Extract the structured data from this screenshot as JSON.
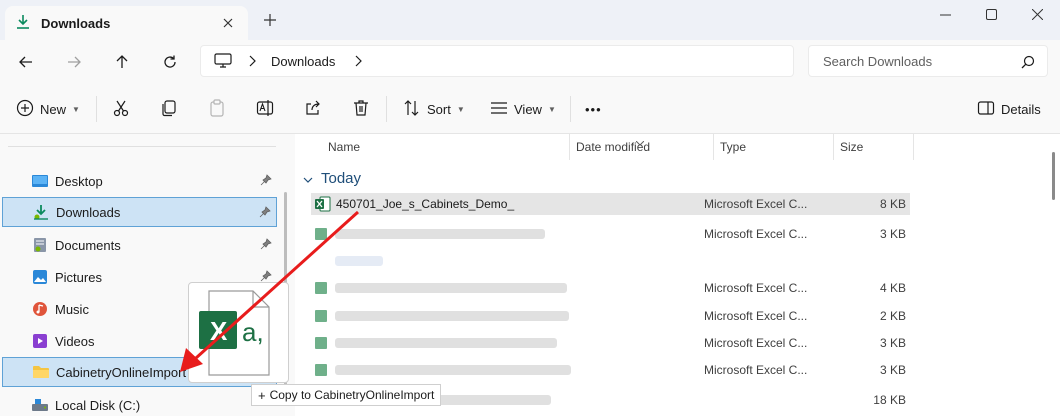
{
  "window": {
    "tab_title": "Downloads",
    "tab_icon": "download-icon",
    "new_tab_symbol": "+"
  },
  "address": {
    "crumb": "Downloads"
  },
  "search": {
    "placeholder": "Search Downloads"
  },
  "commandbar": {
    "new_label": "New",
    "sort_label": "Sort",
    "view_label": "View",
    "more_label": "•••",
    "details_label": "Details"
  },
  "sidebar": {
    "items": [
      {
        "label": "Desktop",
        "icon": "desktop-icon",
        "pinned": true
      },
      {
        "label": "Downloads",
        "icon": "downloads-icon",
        "pinned": true,
        "selected": true
      },
      {
        "label": "Documents",
        "icon": "documents-icon",
        "pinned": true
      },
      {
        "label": "Pictures",
        "icon": "pictures-icon",
        "pinned": true
      },
      {
        "label": "Music",
        "icon": "music-icon",
        "pinned": false
      },
      {
        "label": "Videos",
        "icon": "videos-icon",
        "pinned": false
      },
      {
        "label": "CabinetryOnlineImport",
        "icon": "folder-icon",
        "pinned": false,
        "drop_target": true
      },
      {
        "label": "Local Disk (C:)",
        "icon": "drive-icon",
        "pinned": false
      }
    ]
  },
  "filelist": {
    "columns": {
      "name": "Name",
      "date": "Date modified",
      "type": "Type",
      "size": "Size"
    },
    "group_label": "Today",
    "rows": [
      {
        "name": "450701_Joe_s_Cabinets_Demo_",
        "type": "Microsoft Excel C...",
        "size": "8 KB",
        "selected": true
      },
      {
        "name": "",
        "type": "Microsoft Excel C...",
        "size": "3 KB"
      },
      {
        "name": "",
        "type": "",
        "size": ""
      },
      {
        "name": "",
        "type": "Microsoft Excel C...",
        "size": "4 KB"
      },
      {
        "name": "",
        "type": "Microsoft Excel C...",
        "size": "2 KB"
      },
      {
        "name": "",
        "type": "Microsoft Excel C...",
        "size": "3 KB"
      },
      {
        "name": "",
        "type": "Microsoft Excel C...",
        "size": "3 KB"
      },
      {
        "name": "",
        "type": "",
        "size": "18 KB"
      }
    ]
  },
  "drag": {
    "tooltip": "Copy to CabinetryOnlineImport",
    "icon": "excel-file-icon",
    "badge_text": "a,",
    "badge_letter": "X"
  },
  "colors": {
    "accent": "#0f6cbd",
    "selection": "#cde3f5",
    "excel": "#1d7044",
    "arrow": "#e81c1c"
  }
}
